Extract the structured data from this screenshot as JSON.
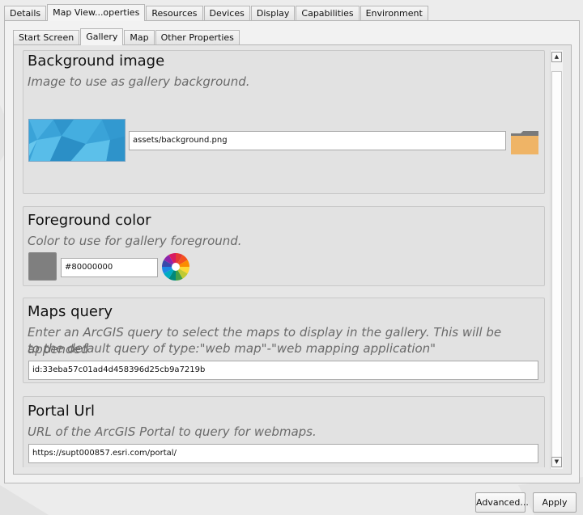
{
  "tabs": [
    "Details",
    "Map View...operties",
    "Resources",
    "Devices",
    "Display",
    "Capabilities",
    "Environment"
  ],
  "active_tab": "Map View...operties",
  "sub_tabs": [
    "Start Screen",
    "Gallery",
    "Map",
    "Other Properties"
  ],
  "active_sub_tab": "Gallery",
  "sections": {
    "background_image": {
      "title": "Background image",
      "description": "Image to use as gallery background.",
      "value": "assets/background.png"
    },
    "foreground_color": {
      "title": "Foreground color",
      "description": "Color to use for gallery foreground.",
      "value": "#80000000",
      "swatch_color": "#7f7f7f"
    },
    "maps_query": {
      "title": "Maps query",
      "description_line1": "Enter an ArcGIS query to select the maps to display in the gallery. This will be appended",
      "description_line2": "to the default query of type:\"web map\"-\"web mapping application\"",
      "value": "id:33eba57c01ad4d458396d25cb9a7219b"
    },
    "portal_url": {
      "title": "Portal Url",
      "description": "URL of the ArcGIS Portal to query for webmaps.",
      "value": "https://supt000857.esri.com/portal/"
    }
  },
  "buttons": {
    "advanced": "Advanced...",
    "apply": "Apply"
  },
  "scrollbar": {
    "up": "▲",
    "down": "▼"
  },
  "colors": {
    "folder": "#efb466",
    "thumbnail": "#3aa3d8"
  }
}
